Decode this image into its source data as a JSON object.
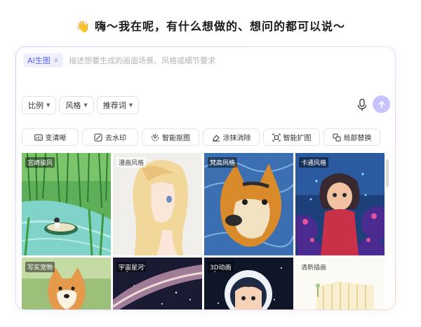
{
  "headline": {
    "wave": "👋",
    "text": "嗨～我在呢，有什么想做的、想问的都可以说～"
  },
  "prompt": {
    "tag_label": "AI生图",
    "tag_close": "×",
    "placeholder": "描述想要生成的画面场景、风格或细节要求"
  },
  "options": [
    {
      "label": "比例"
    },
    {
      "label": "风格"
    },
    {
      "label": "推荐词"
    }
  ],
  "tools": [
    {
      "label": "变清晰",
      "icon": "hd-icon"
    },
    {
      "label": "去水印",
      "icon": "watermark-icon"
    },
    {
      "label": "智能抠图",
      "icon": "cutout-icon"
    },
    {
      "label": "涂抹消除",
      "icon": "eraser-icon"
    },
    {
      "label": "智能扩图",
      "icon": "expand-icon"
    },
    {
      "label": "局部替换",
      "icon": "replace-icon"
    }
  ],
  "gallery": [
    {
      "label": "宫崎骏风"
    },
    {
      "label": "漫画风格"
    },
    {
      "label": "梵高风格"
    },
    {
      "label": "卡通风格"
    },
    {
      "label": "写实宠物"
    },
    {
      "label": "宇宙星河"
    },
    {
      "label": "3D动画"
    },
    {
      "label": "清新插画"
    }
  ],
  "colors": {
    "accent": "#5965ff",
    "send": "#c8c3ff"
  }
}
